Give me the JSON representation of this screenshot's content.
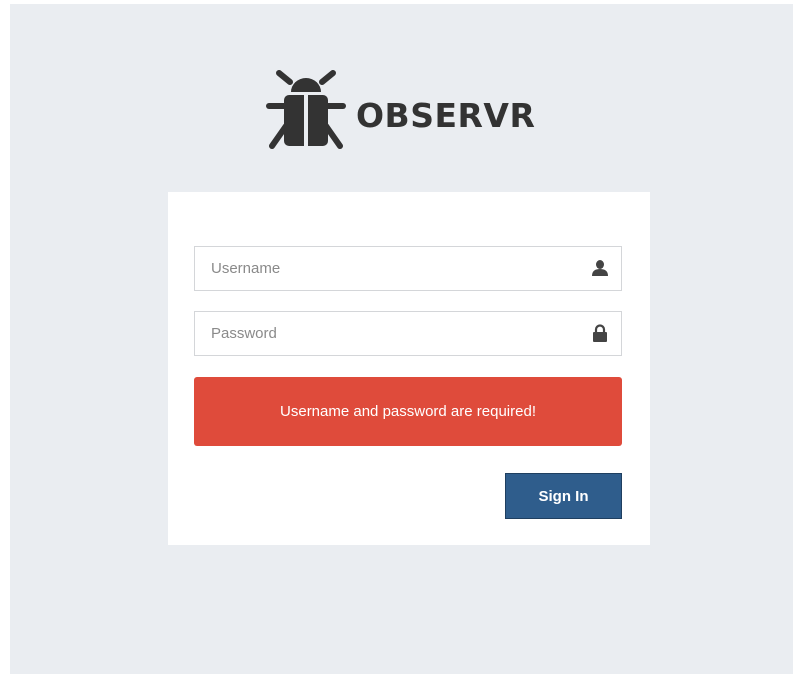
{
  "brand": {
    "name": "OBSERVR",
    "logo_icon": "bug-icon",
    "color": "#333333"
  },
  "login_form": {
    "username": {
      "placeholder": "Username",
      "value": "",
      "icon": "user-icon"
    },
    "password": {
      "placeholder": "Password",
      "value": "",
      "icon": "lock-icon"
    },
    "error_message": "Username and password are required!",
    "submit_label": "Sign In"
  },
  "colors": {
    "background": "#eaedf1",
    "error": "#df4b3b",
    "primary": "#2f5d8c"
  }
}
